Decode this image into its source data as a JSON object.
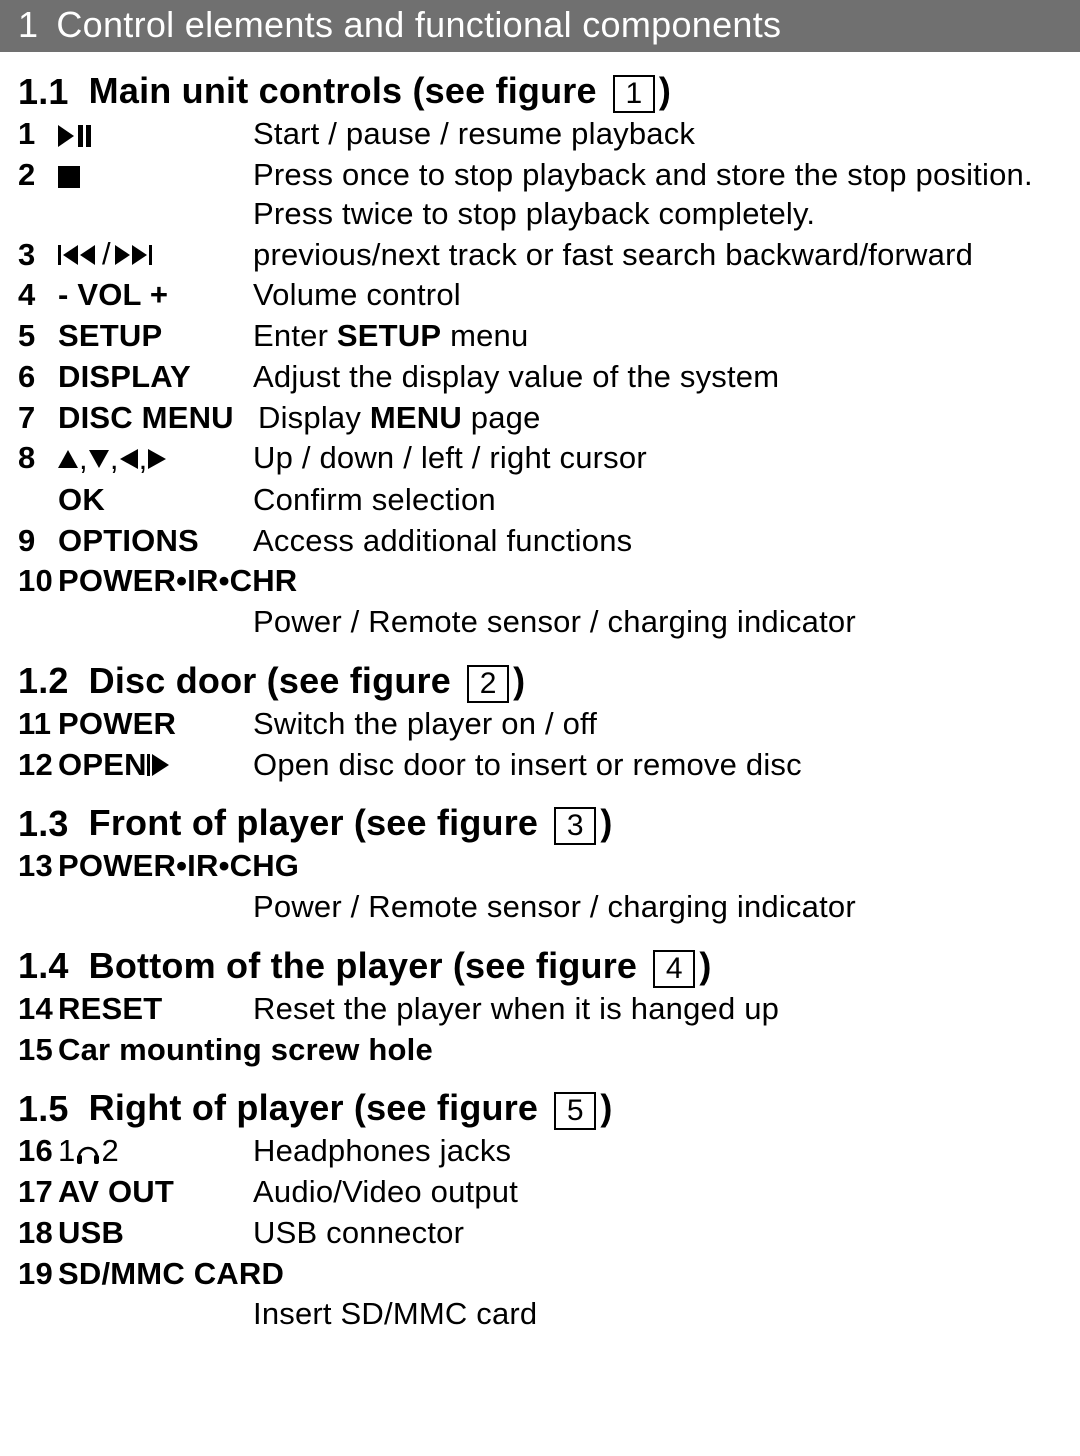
{
  "header": {
    "num": "1",
    "title": "Control elements and functional components"
  },
  "sections": {
    "s11": {
      "num": "1.1",
      "title": "Main unit controls (see figure ",
      "figure": "1",
      "close": ")"
    },
    "s12": {
      "num": "1.2",
      "title": "Disc door (see figure ",
      "figure": "2",
      "close": ")"
    },
    "s13": {
      "num": "1.3",
      "title": "Front of player (see figure ",
      "figure": "3",
      "close": ")"
    },
    "s14": {
      "num": "1.4",
      "title": "Bottom of the player (see figure ",
      "figure": "4",
      "close": ")"
    },
    "s15": {
      "num": "1.5",
      "title": "Right of player (see figure ",
      "figure": "5",
      "close": ")"
    }
  },
  "items": {
    "i1": {
      "n": "1",
      "label": "",
      "desc": "Start / pause / resume playback"
    },
    "i2": {
      "n": "2",
      "label": "",
      "desc": "Press once to stop playback and store the stop position. Press twice to stop playback completely."
    },
    "i3": {
      "n": "3",
      "label": "",
      "desc": "previous/next track or fast search backward/forward"
    },
    "i4": {
      "n": "4",
      "label": "- VOL +",
      "desc": "Volume control"
    },
    "i5": {
      "n": "5",
      "label": "SETUP",
      "desc_pre": "Enter ",
      "bold": "SETUP",
      "desc_post": " menu"
    },
    "i6": {
      "n": "6",
      "label": "DISPLAY",
      "desc": "Adjust the display value of the system"
    },
    "i7": {
      "n": "7",
      "label": "DISC MENU",
      "desc_pre": "Display ",
      "bold": "MENU",
      "desc_post": " page"
    },
    "i8": {
      "n": "8",
      "label": "",
      "desc": "Up / down / left / right cursor"
    },
    "i8b": {
      "n": "",
      "label": "OK",
      "desc": "Confirm selection"
    },
    "i9": {
      "n": "9",
      "label": "OPTIONS",
      "desc": "Access additional functions"
    },
    "i10": {
      "n": "10",
      "label": "POWER•IR•CHR",
      "desc": "Power / Remote sensor / charging indicator"
    },
    "i11": {
      "n": "11",
      "label": "POWER",
      "desc": "Switch the player on / off"
    },
    "i12": {
      "n": "12",
      "label": "OPEN ",
      "desc": "Open disc door to insert or remove disc"
    },
    "i13": {
      "n": "13",
      "label": "POWER•IR•CHG",
      "desc": "Power / Remote sensor / charging indicator"
    },
    "i14": {
      "n": "14",
      "label": "RESET",
      "desc": "Reset the player when it is hanged up"
    },
    "i15": {
      "n": "15",
      "label": "Car mounting screw hole",
      "desc": ""
    },
    "i16": {
      "n": "16",
      "label_pre": "1 ",
      "label_post": " 2",
      "desc": "Headphones jacks"
    },
    "i17": {
      "n": "17",
      "label": "AV OUT",
      "desc": "Audio/Video output"
    },
    "i18": {
      "n": "18",
      "label": "USB",
      "desc": "USB connector"
    },
    "i19": {
      "n": "19",
      "label": "SD/MMC CARD",
      "desc": "Insert SD/MMC card"
    }
  },
  "icons": {
    "slash": " / ",
    "commas": ", "
  }
}
